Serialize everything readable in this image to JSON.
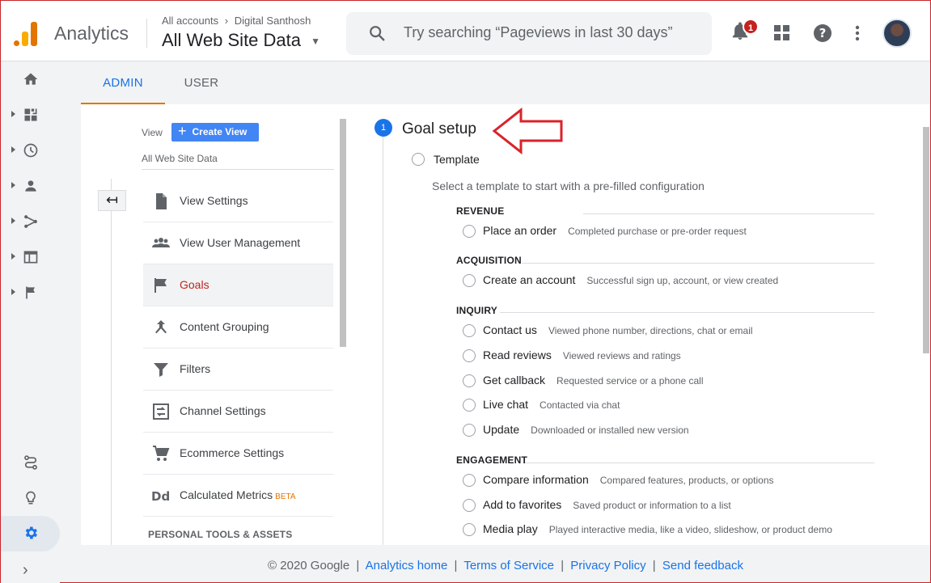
{
  "header": {
    "app_name": "Analytics",
    "breadcrumb_account": "All accounts",
    "breadcrumb_property": "Digital Santhosh",
    "view_selector": "All Web Site Data",
    "search_placeholder": "Try searching “Pageviews in last 30 days”",
    "notification_count": "1"
  },
  "tabs": [
    {
      "label": "ADMIN",
      "active": true
    },
    {
      "label": "USER",
      "active": false
    }
  ],
  "view_column": {
    "label": "View",
    "create_button": "Create View",
    "view_name": "All Web Site Data",
    "items": [
      {
        "label": "View Settings",
        "icon": "document-icon"
      },
      {
        "label": "View User Management",
        "icon": "users-icon"
      },
      {
        "label": "Goals",
        "icon": "flag-icon",
        "active": true
      },
      {
        "label": "Content Grouping",
        "icon": "content-grouping-icon"
      },
      {
        "label": "Filters",
        "icon": "filter-icon"
      },
      {
        "label": "Channel Settings",
        "icon": "channel-settings-icon"
      },
      {
        "label": "Ecommerce Settings",
        "icon": "cart-icon"
      },
      {
        "label": "Calculated Metrics",
        "icon": "calculated-metrics-icon",
        "badge": "BETA"
      }
    ],
    "section_title": "PERSONAL TOOLS & ASSETS"
  },
  "goal_setup": {
    "step_number": "1",
    "title": "Goal setup",
    "template_label": "Template",
    "template_description": "Select a template to start with a pre-filled configuration",
    "categories": [
      {
        "name": "REVENUE",
        "options": [
          {
            "name": "Place an order",
            "desc": "Completed purchase or pre-order request"
          }
        ]
      },
      {
        "name": "ACQUISITION",
        "options": [
          {
            "name": "Create an account",
            "desc": "Successful sign up, account, or view created"
          }
        ]
      },
      {
        "name": "INQUIRY",
        "options": [
          {
            "name": "Contact us",
            "desc": "Viewed phone number, directions, chat or email"
          },
          {
            "name": "Read reviews",
            "desc": "Viewed reviews and ratings"
          },
          {
            "name": "Get callback",
            "desc": "Requested service or a phone call"
          },
          {
            "name": "Live chat",
            "desc": "Contacted via chat"
          },
          {
            "name": "Update",
            "desc": "Downloaded or installed new version"
          }
        ]
      },
      {
        "name": "ENGAGEMENT",
        "options": [
          {
            "name": "Compare information",
            "desc": "Compared features, products, or options"
          },
          {
            "name": "Add to favorites",
            "desc": "Saved product or information to a list"
          },
          {
            "name": "Media play",
            "desc": "Played interactive media, like a video, slideshow, or product demo"
          }
        ]
      }
    ]
  },
  "footer": {
    "copyright": "© 2020 Google",
    "links": [
      "Analytics home",
      "Terms of Service",
      "Privacy Policy",
      "Send feedback"
    ],
    "separator": "|"
  },
  "colors": {
    "accent_blue": "#1a73e8",
    "brand_orange": "#e37400",
    "active_red": "#c5221f",
    "annotation_arrow": "#d9232a"
  }
}
